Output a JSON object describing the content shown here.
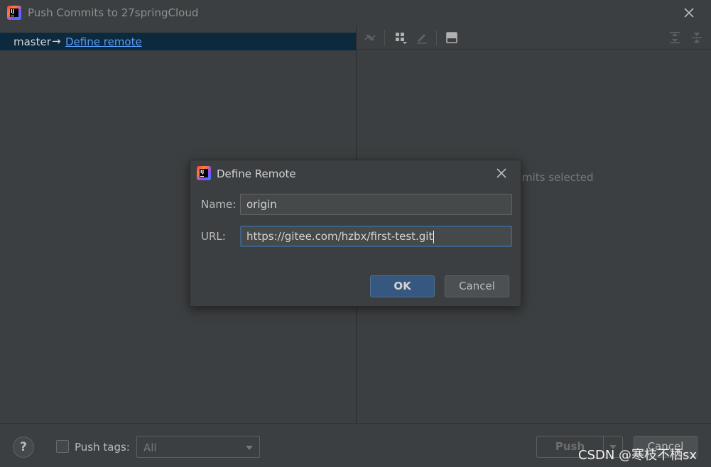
{
  "window": {
    "title": "Push Commits to 27springCloud",
    "logo_icon": "intellij-idea-icon",
    "close_icon": "close-icon"
  },
  "commits_tree": {
    "branch": "master",
    "arrow": "→",
    "target_link": "Define remote"
  },
  "toolbar": {
    "icons": [
      "fetch-arrows-icon",
      "group-by-icon",
      "edit-icon",
      "preview-icon",
      "expand-all-icon",
      "collapse-all-icon"
    ]
  },
  "details": {
    "empty_text": "mits selected"
  },
  "bottom": {
    "help_label": "?",
    "push_tags_label": "Push tags:",
    "tags_select_value": "All",
    "push_label": "Push",
    "cancel_label": "Cancel",
    "watermark": "CSDN @寒枝不栖sx"
  },
  "dialog": {
    "title": "Define Remote",
    "name_label": "Name:",
    "name_value": "origin",
    "url_label": "URL:",
    "url_value": "https://gitee.com/hzbx/first-test.git",
    "ok_label": "OK",
    "cancel_label": "Cancel"
  },
  "colors": {
    "background": "#3c3f41",
    "selection": "#0d293e",
    "link": "#589df6",
    "primary_button": "#365880",
    "focus_border": "#3d6185"
  }
}
